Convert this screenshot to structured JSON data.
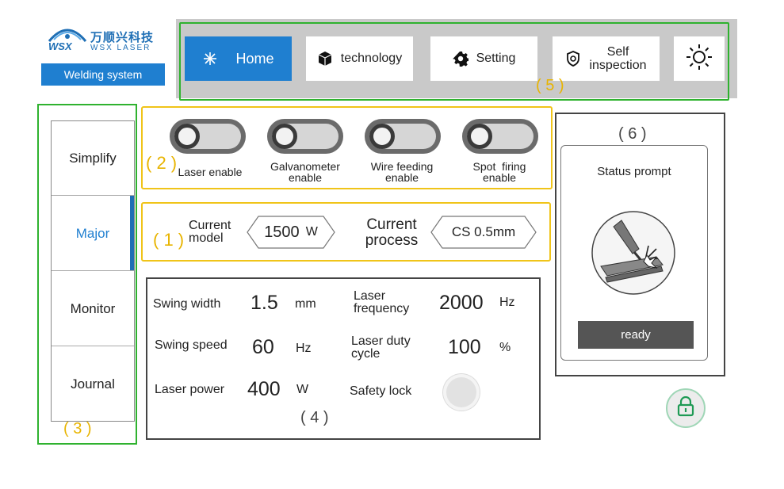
{
  "brand": {
    "cn_name": "万顺兴科技",
    "en_name": "WSX LASER",
    "mark_text": "WSX",
    "subtitle": "Welding system",
    "color": "#1f7fd0"
  },
  "nav": {
    "home": {
      "label": "Home",
      "icon": "sparkle-icon",
      "active": true
    },
    "technology": {
      "label": "technology",
      "icon": "cube-icon"
    },
    "setting": {
      "label": "Setting",
      "icon": "gear-icon"
    },
    "self_inspection": {
      "label_line1": "Self",
      "label_line2": "inspection",
      "icon": "shield-check-icon"
    },
    "theme": {
      "icon": "sun-icon"
    },
    "zone_label": "( 5 )"
  },
  "sidebar": {
    "items": [
      {
        "label": "Simplify",
        "active": false
      },
      {
        "label": "Major",
        "active": true
      },
      {
        "label": "Monitor",
        "active": false
      },
      {
        "label": "Journal",
        "active": false
      }
    ],
    "zone_label": "( 3 )"
  },
  "toggles": {
    "zone_label": "( 2 )",
    "items": [
      {
        "label_line1": "Laser enable",
        "label_line2": "",
        "on": false
      },
      {
        "label_line1": "Galvanometer",
        "label_line2": "enable",
        "on": false
      },
      {
        "label_line1": "Wire feeding",
        "label_line2": "enable",
        "on": false
      },
      {
        "label_line1": "Spot  firing",
        "label_line2": "enable",
        "on": false
      }
    ]
  },
  "model_process": {
    "zone_label": "( 1 )",
    "model_label_line1": "Current",
    "model_label_line2": "model",
    "model_value": "1500",
    "model_unit": "W",
    "process_label_line1": "Current",
    "process_label_line2": "process",
    "process_value": "CS 0.5mm"
  },
  "params": {
    "zone_label": "( 4 )",
    "swing_width": {
      "label": "Swing width",
      "value": "1.5",
      "unit": "mm"
    },
    "swing_speed": {
      "label": "Swing speed",
      "value": "60",
      "unit": "Hz"
    },
    "laser_power": {
      "label": "Laser power",
      "value": "400",
      "unit": "W"
    },
    "laser_frequency": {
      "label_line1": "Laser",
      "label_line2": "frequency",
      "value": "2000",
      "unit": "Hz"
    },
    "laser_duty_cycle": {
      "label_line1": "Laser duty",
      "label_line2": "cycle",
      "value": "100",
      "unit": "%"
    },
    "safety_lock": {
      "label": "Safety lock"
    }
  },
  "status": {
    "zone_label": "( 6 )",
    "title": "Status prompt",
    "state": "ready",
    "icon": "welding-torch-icon"
  },
  "lock": {
    "icon": "padlock-icon"
  },
  "colors": {
    "accent": "#1f7fd0",
    "zone_green": "#2fb22f",
    "zone_yellow": "#f0c419",
    "label_yellow": "#e8b400"
  }
}
